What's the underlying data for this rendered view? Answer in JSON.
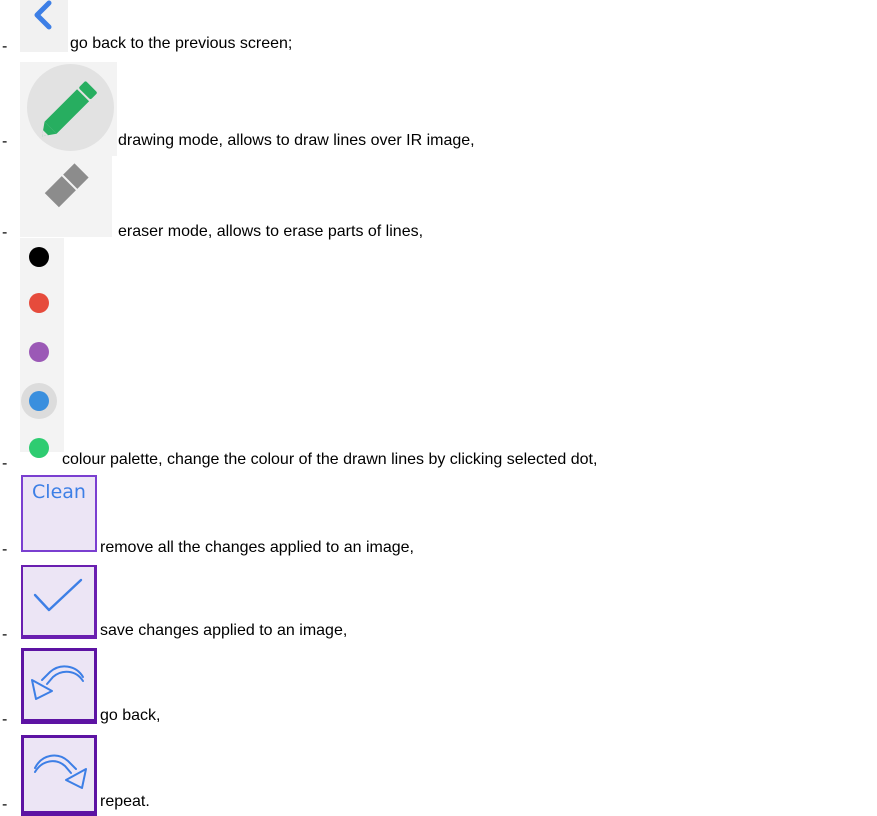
{
  "items": [
    {
      "dash": "-",
      "text": "go back to the previous screen;"
    },
    {
      "dash": "-",
      "text": "drawing mode, allows to draw lines over IR image,"
    },
    {
      "dash": "-",
      "text": "eraser mode, allows to erase parts of lines,"
    },
    {
      "dash": "-",
      "text": "colour palette, change the colour of the drawn lines by clicking selected dot,"
    },
    {
      "dash": "-",
      "text": "remove all the changes applied to an image,"
    },
    {
      "dash": "-",
      "text": "save changes applied to an image,"
    },
    {
      "dash": "-",
      "text": "go back,"
    },
    {
      "dash": "-",
      "text": "repeat."
    }
  ],
  "buttons": {
    "clean_label": "Clean"
  },
  "icons": {
    "back": "chevron-left-icon",
    "draw": "pencil-icon",
    "erase": "eraser-icon",
    "save": "checkmark-icon",
    "undo": "undo-icon",
    "redo": "redo-icon"
  },
  "palette": {
    "colors": [
      "#000000",
      "#e64b3c",
      "#9b59b6",
      "#3a8fde",
      "#2ecc71"
    ],
    "selected_index": 3
  },
  "colors": {
    "accent_blue": "#3d7fe6",
    "pencil_green": "#27ae60",
    "eraser_gray": "#8c8c8c",
    "button_fill": "#ece5f5",
    "button_border": "#6a1fb0"
  }
}
